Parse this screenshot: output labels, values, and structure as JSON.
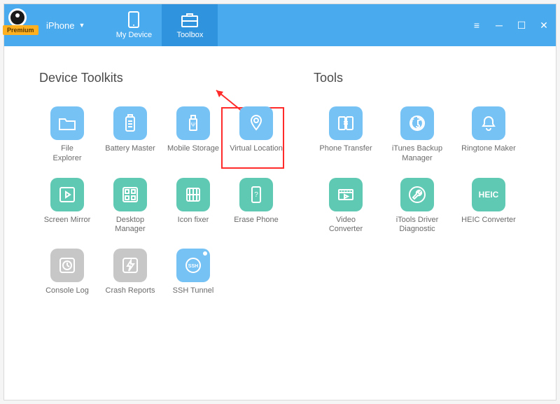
{
  "header": {
    "premium_label": "Premium",
    "device_label": "iPhone",
    "tabs": {
      "device": "My Device",
      "toolbox": "Toolbox"
    }
  },
  "sections": {
    "toolkits_title": "Device Toolkits",
    "tools_title": "Tools"
  },
  "toolkits": {
    "file_explorer": "File\nExplorer",
    "battery_master": "Battery Master",
    "mobile_storage": "Mobile Storage",
    "virtual_location": "Virtual Location",
    "screen_mirror": "Screen Mirror",
    "desktop_manager": "Desktop\nManager",
    "icon_fixer": "Icon fixer",
    "erase_phone": "Erase Phone",
    "console_log": "Console Log",
    "crash_reports": "Crash Reports",
    "ssh_tunnel": "SSH Tunnel"
  },
  "tools": {
    "phone_transfer": "Phone Transfer",
    "itunes_backup": "iTunes Backup\nManager",
    "ringtone_maker": "Ringtone Maker",
    "video_converter": "Video\nConverter",
    "driver_diag": "iTools Driver\nDiagnostic",
    "heic_converter": "HEIC Converter",
    "heic_badge": "HEIC"
  },
  "colors": {
    "header": "#49aaee",
    "header_active": "#2f93dd",
    "icon_blue": "#76c2f5",
    "icon_teal": "#5fc9b3",
    "icon_gray": "#c7c7c7",
    "highlight": "#ff2a2a"
  }
}
